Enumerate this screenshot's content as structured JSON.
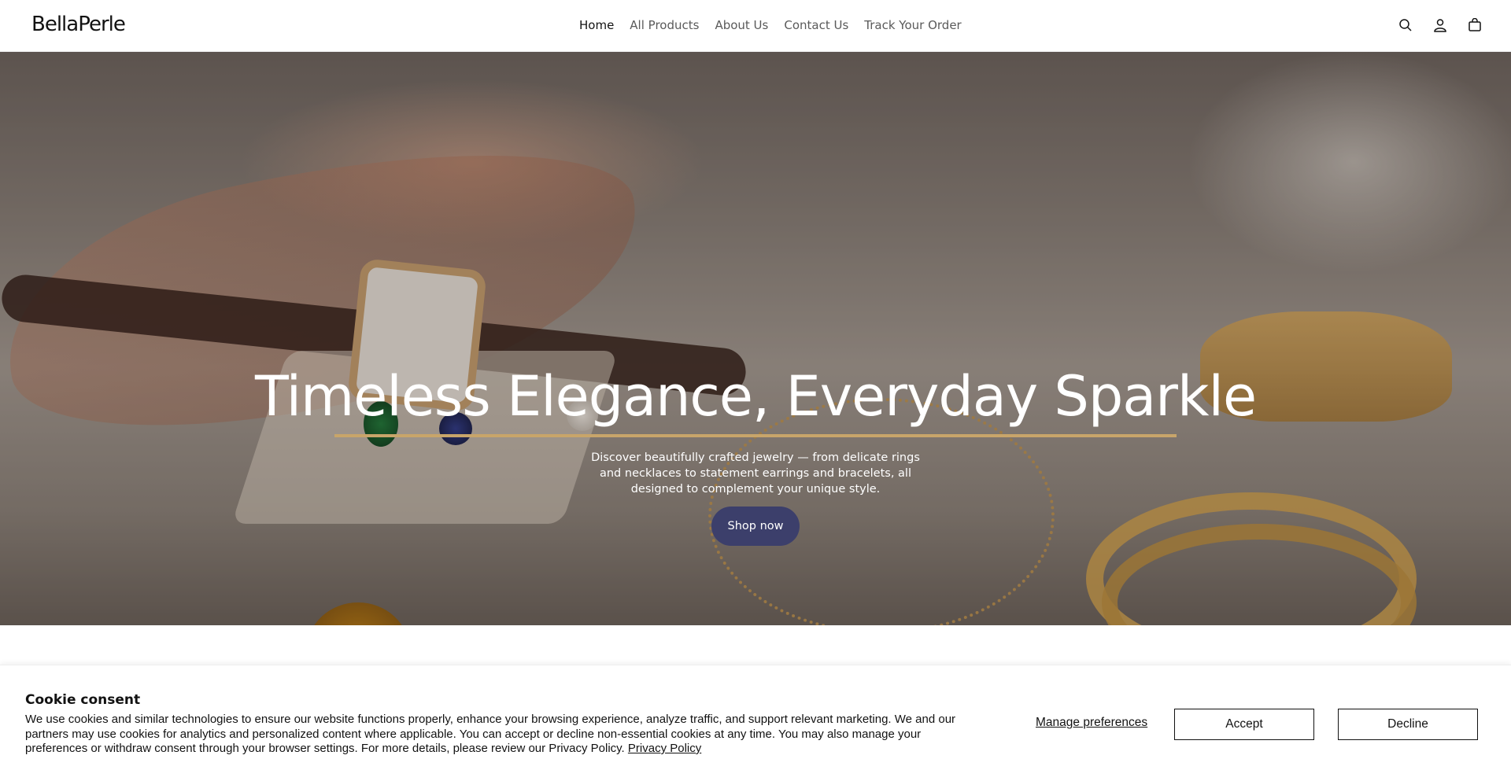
{
  "brand": {
    "logo_text": "BellaPerle"
  },
  "nav": {
    "items": [
      {
        "label": "Home",
        "active": true
      },
      {
        "label": "All Products",
        "active": false
      },
      {
        "label": "About Us",
        "active": false
      },
      {
        "label": "Contact Us",
        "active": false
      },
      {
        "label": "Track Your Order",
        "active": false
      }
    ]
  },
  "header_icons": [
    "search-icon",
    "account-icon",
    "cart-icon"
  ],
  "hero": {
    "title": "Timeless Elegance, Everyday Sparkle",
    "description": "Discover beautifully crafted jewelry — from delicate rings and necklaces to statement earrings and bracelets, all designed to complement your unique style.",
    "cta_label": "Shop now",
    "accent_color": "#c8a56a",
    "button_color": "#3c3f6b"
  },
  "cookie": {
    "title": "Cookie consent",
    "body": "We use cookies and similar technologies to ensure our website functions properly, enhance your browsing experience, analyze traffic, and support relevant marketing. We and our partners may use cookies for analytics and personalized content where applicable. You can accept or decline non-essential cookies at any time. You may also manage your preferences or withdraw consent through your browser settings. For more details, please review our Privacy Policy.",
    "privacy_link": "Privacy Policy",
    "manage_label": "Manage preferences",
    "accept_label": "Accept",
    "decline_label": "Decline"
  }
}
